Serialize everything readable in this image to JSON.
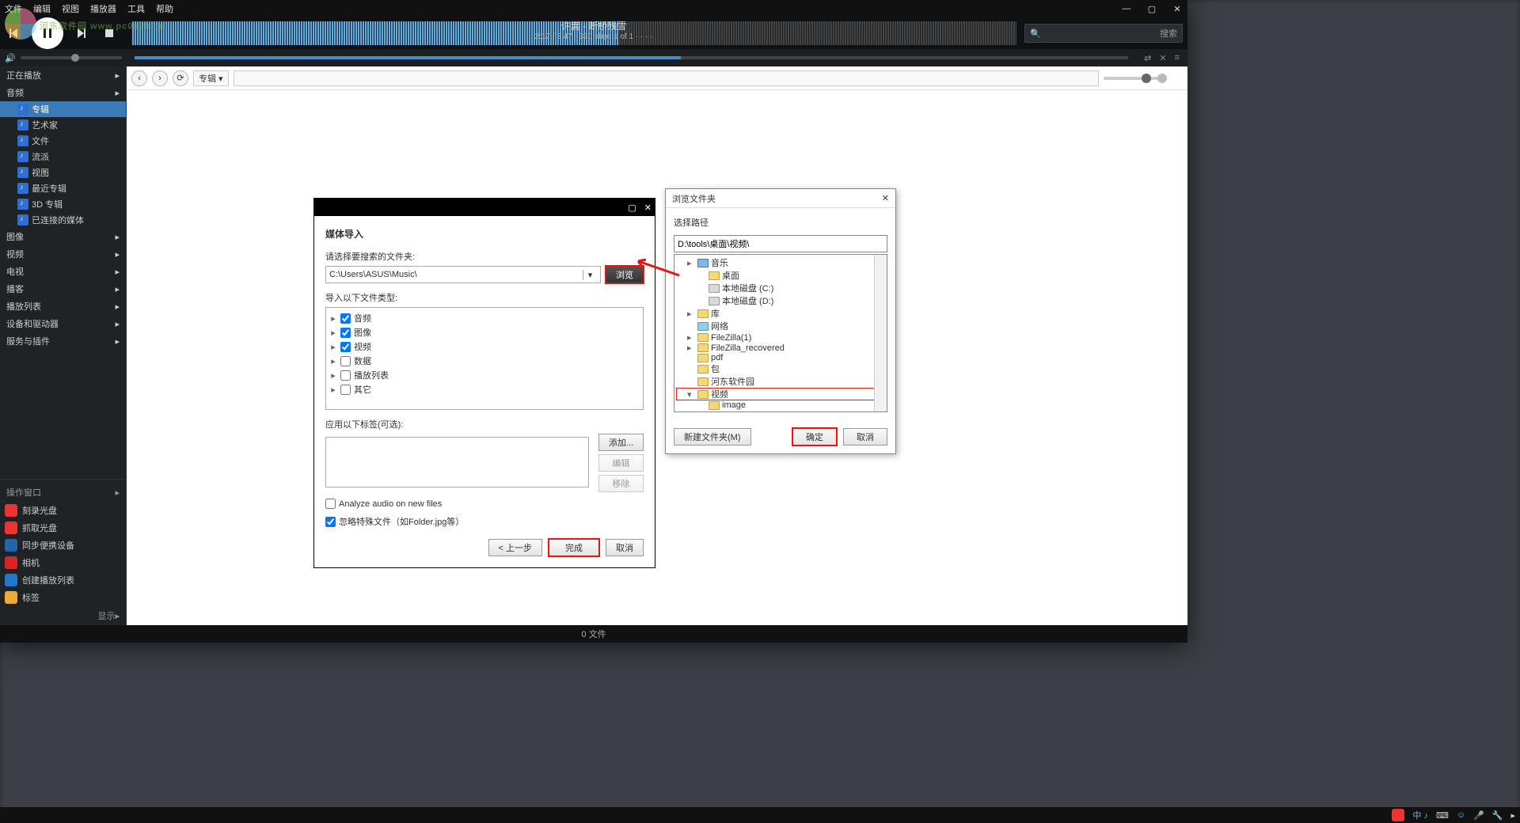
{
  "watermark": "河东软件园 www.pc0359.cn",
  "menubar": {
    "items": [
      "文件",
      "编辑",
      "视图",
      "播放器",
      "工具",
      "帮助"
    ]
  },
  "player": {
    "title": "许嵩 - 断桥残雪",
    "time": "2:17 / 3:47 - 320 kbps   1 of 1  · · · ·",
    "search_icon": "🔍",
    "search_ph": "搜索"
  },
  "sidebar": {
    "cats": [
      {
        "label": "正在播放",
        "sel": false
      },
      {
        "label": "音频",
        "sel": true,
        "items": [
          {
            "label": "专辑",
            "sel": true
          },
          {
            "label": "艺术家"
          },
          {
            "label": "文件"
          },
          {
            "label": "流派"
          },
          {
            "label": "视图"
          },
          {
            "label": "最近专辑"
          },
          {
            "label": "3D 专辑"
          },
          {
            "label": "已连接的媒体"
          }
        ]
      },
      {
        "label": "图像"
      },
      {
        "label": "视频"
      },
      {
        "label": "电视"
      },
      {
        "label": "播客"
      },
      {
        "label": "播放列表"
      },
      {
        "label": "设备和驱动器"
      },
      {
        "label": "服务与插件"
      }
    ],
    "panel_title": "操作窗口",
    "actions": [
      {
        "label": "刻录光盘",
        "c": "#e33"
      },
      {
        "label": "抓取光盘",
        "c": "#e33"
      },
      {
        "label": "同步便携设备",
        "c": "#26a"
      },
      {
        "label": "相机",
        "c": "#d22"
      },
      {
        "label": "创建播放列表",
        "c": "#27c"
      },
      {
        "label": "标签",
        "c": "#ea3"
      }
    ],
    "footer": "显示"
  },
  "toolbar2": {
    "album": "专辑 ▾"
  },
  "statusbar": "0 文件",
  "import": {
    "heading": "媒体导入",
    "lbl_path": "请选择要搜索的文件夹:",
    "path": "C:\\Users\\ASUS\\Music\\",
    "browse": "浏览",
    "lbl_types": "导入以下文件类型:",
    "types": [
      {
        "label": "音频",
        "chk": true
      },
      {
        "label": "图像",
        "chk": true
      },
      {
        "label": "视频",
        "chk": true
      },
      {
        "label": "数据",
        "chk": false
      },
      {
        "label": "播放列表",
        "chk": false
      },
      {
        "label": "其它",
        "chk": false
      }
    ],
    "lbl_tags": "应用以下标签(可选):",
    "btn_add": "添加...",
    "btn_edit": "编辑",
    "btn_del": "移除",
    "chk_analyze": "Analyze audio on new files",
    "chk_ignore": "忽略特殊文件（如Folder.jpg等）",
    "prev": "< 上一步",
    "finish": "完成",
    "cancel": "取消"
  },
  "browse": {
    "title": "浏览文件夹",
    "lbl": "选择路径",
    "path": "D:\\tools\\桌面\\视频\\",
    "tree": [
      {
        "ind": 1,
        "ico": "blue",
        "label": "音乐",
        "exp": "▸"
      },
      {
        "ind": 2,
        "ico": "fold",
        "label": "桌面"
      },
      {
        "ind": 2,
        "ico": "drive",
        "label": "本地磁盘 (C:)"
      },
      {
        "ind": 2,
        "ico": "drive",
        "label": "本地磁盘 (D:)"
      },
      {
        "ind": 1,
        "ico": "fold",
        "label": "库",
        "exp": "▸"
      },
      {
        "ind": 1,
        "ico": "net",
        "label": "网络"
      },
      {
        "ind": 1,
        "ico": "fold",
        "label": "FileZilla(1)",
        "exp": "▸"
      },
      {
        "ind": 1,
        "ico": "fold",
        "label": "FileZilla_recovered",
        "exp": "▸"
      },
      {
        "ind": 1,
        "ico": "fold",
        "label": "pdf"
      },
      {
        "ind": 1,
        "ico": "fold",
        "label": "包"
      },
      {
        "ind": 1,
        "ico": "fold",
        "label": "河东软件园"
      },
      {
        "ind": 1,
        "ico": "fold",
        "label": "视频",
        "exp": "▾",
        "sel": true
      },
      {
        "ind": 2,
        "ico": "fold",
        "label": "image"
      }
    ],
    "newfolder": "新建文件夹(M)",
    "ok": "确定",
    "cancel": "取消"
  }
}
